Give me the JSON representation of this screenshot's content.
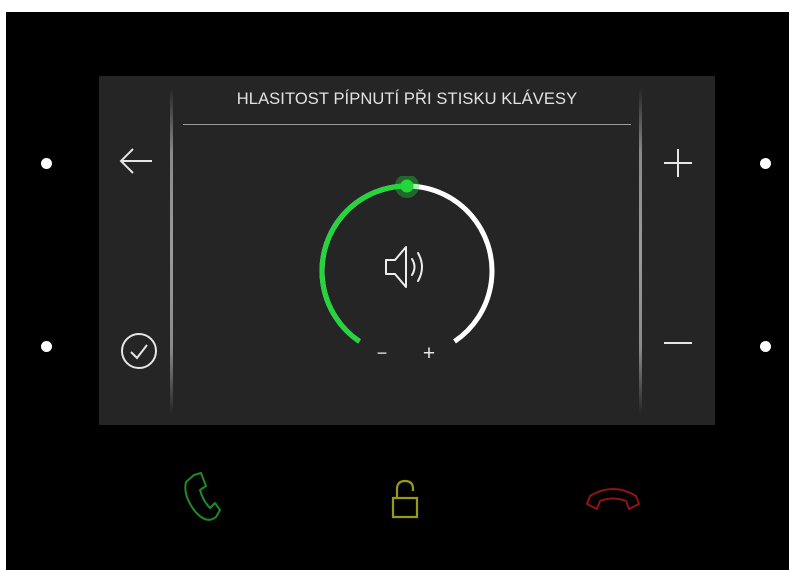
{
  "screen": {
    "title": "HLASITOST PÍPNUTÍ PŘI STISKU KLÁVESY"
  },
  "volume_dial": {
    "level": 0.5,
    "minus_label": "−",
    "plus_label": "+",
    "icon": "speaker-icon"
  },
  "icons": {
    "back": "arrow-left-icon",
    "confirm": "check-circle-icon",
    "increase": "plus-icon",
    "decrease": "minus-icon",
    "call_answer": "phone-answer-icon",
    "door_unlock": "unlock-icon",
    "call_hangup": "phone-hangup-icon"
  },
  "colors": {
    "accent_green": "#22d63b",
    "dial_white": "#ffffff",
    "screen_bg": "#252525",
    "device_bg": "#000000",
    "answer_green": "#1f8a2a",
    "unlock_yellow": "#9a9a12",
    "hangup_red": "#8f1414"
  }
}
